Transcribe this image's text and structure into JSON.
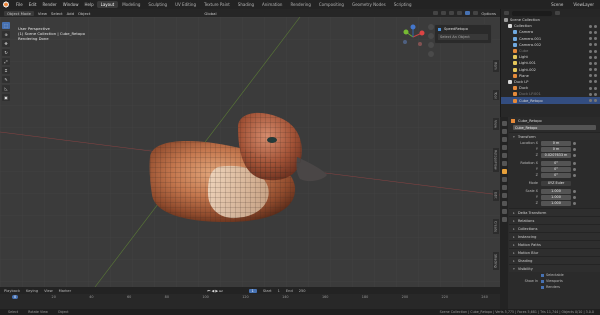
{
  "menu": {
    "items": [
      "File",
      "Edit",
      "Render",
      "Window",
      "Help"
    ],
    "tabs": [
      "Layout",
      "Modeling",
      "Sculpting",
      "UV Editing",
      "Texture Paint",
      "Shading",
      "Animation",
      "Rendering",
      "Compositing",
      "Geometry Nodes",
      "Scripting"
    ],
    "active_tab": "Layout",
    "scene_label": "Scene",
    "view_layer_label": "ViewLayer"
  },
  "viewport_header": {
    "mode": "Object Mode",
    "menus": [
      "View",
      "Select",
      "Add",
      "Object"
    ],
    "orientation": "Global",
    "options_label": "Options"
  },
  "viewport_info": {
    "line1": "User Perspective",
    "line2": "(1) Scene Collection | Cube_Retopo",
    "line3": "Rendering Done"
  },
  "popup": {
    "title": "SpeedRetopo",
    "select_label": "Select An Object"
  },
  "side_tabs": [
    "Item",
    "Tool",
    "View",
    "RetopoFlow",
    "Edit",
    "Create",
    "Shading"
  ],
  "outliner": {
    "root": "Scene Collection",
    "items": [
      {
        "label": "Collection",
        "color": "#d8d8d8",
        "dim": false,
        "selected": false
      },
      {
        "label": "Camera",
        "color": "#6fa9e0",
        "dim": false,
        "selected": false
      },
      {
        "label": "Camera.001",
        "color": "#6fa9e0",
        "dim": false,
        "selected": false
      },
      {
        "label": "Camera.002",
        "color": "#6fa9e0",
        "dim": false,
        "selected": false
      },
      {
        "label": "Cube",
        "color": "#e58a3a",
        "dim": true,
        "selected": false
      },
      {
        "label": "Light",
        "color": "#e5c75a",
        "dim": false,
        "selected": false
      },
      {
        "label": "Light.001",
        "color": "#e5c75a",
        "dim": false,
        "selected": false
      },
      {
        "label": "Light.002",
        "color": "#e5c75a",
        "dim": false,
        "selected": false
      },
      {
        "label": "Plane",
        "color": "#e58a3a",
        "dim": false,
        "selected": false
      },
      {
        "label": "Duck LP",
        "color": "#d8d8d8",
        "dim": false,
        "selected": false
      },
      {
        "label": "Duck",
        "color": "#e58a3a",
        "dim": false,
        "selected": false
      },
      {
        "label": "Duck LP.001",
        "color": "#e58a3a",
        "dim": true,
        "selected": false
      },
      {
        "label": "Cube_Retopo",
        "color": "#e58a3a",
        "dim": false,
        "selected": true
      }
    ]
  },
  "properties": {
    "object_name": "Cube_Retopo",
    "data_name": "Cube_Retopo",
    "sections": {
      "transform": "Transform",
      "delta_transform": "Delta Transform",
      "relations": "Relations",
      "collections": "Collections",
      "instancing": "Instancing",
      "motion_paths": "Motion Paths",
      "motion_blur": "Motion Blur",
      "shading": "Shading",
      "visibility": "Visibility"
    },
    "location": {
      "label_x": "Location X",
      "label_y": "Y",
      "label_z": "Z",
      "x": "0 m",
      "y": "0 m",
      "z": "0.0207633 m"
    },
    "rotation": {
      "label_x": "Rotation X",
      "label_y": "Y",
      "label_z": "Z",
      "x": "0°",
      "y": "0°",
      "z": "0°"
    },
    "mode": {
      "label": "Mode",
      "value": "XYZ Euler"
    },
    "scale": {
      "label_x": "Scale X",
      "label_y": "Y",
      "label_z": "Z",
      "x": "1.000",
      "y": "1.000",
      "z": "1.000"
    },
    "visibility": {
      "selectable": "Selectable",
      "show_in": "Show In",
      "viewports": "Viewports",
      "renders": "Renders"
    }
  },
  "timeline": {
    "menus": [
      "Playback",
      "Keying",
      "View",
      "Marker"
    ],
    "ticks": [
      "0",
      "20",
      "40",
      "60",
      "80",
      "100",
      "120",
      "140",
      "160",
      "180",
      "200",
      "220",
      "240"
    ],
    "current_frame": "1",
    "start_label": "Start",
    "start": "1",
    "end_label": "End",
    "end": "250"
  },
  "statusbar": {
    "select": "Select",
    "rotate": "Rotate View",
    "menu": "Object",
    "version": "Scene Collection | Cube_Retopo | Verts 5,775 | Faces 5,681 | Tris 11,744 | Objects 0/10 | 3.0.0"
  },
  "colors": {
    "accent": "#4772b3",
    "active_tab": "#e8a13a",
    "viewport_bg": "#3b3b3b"
  }
}
